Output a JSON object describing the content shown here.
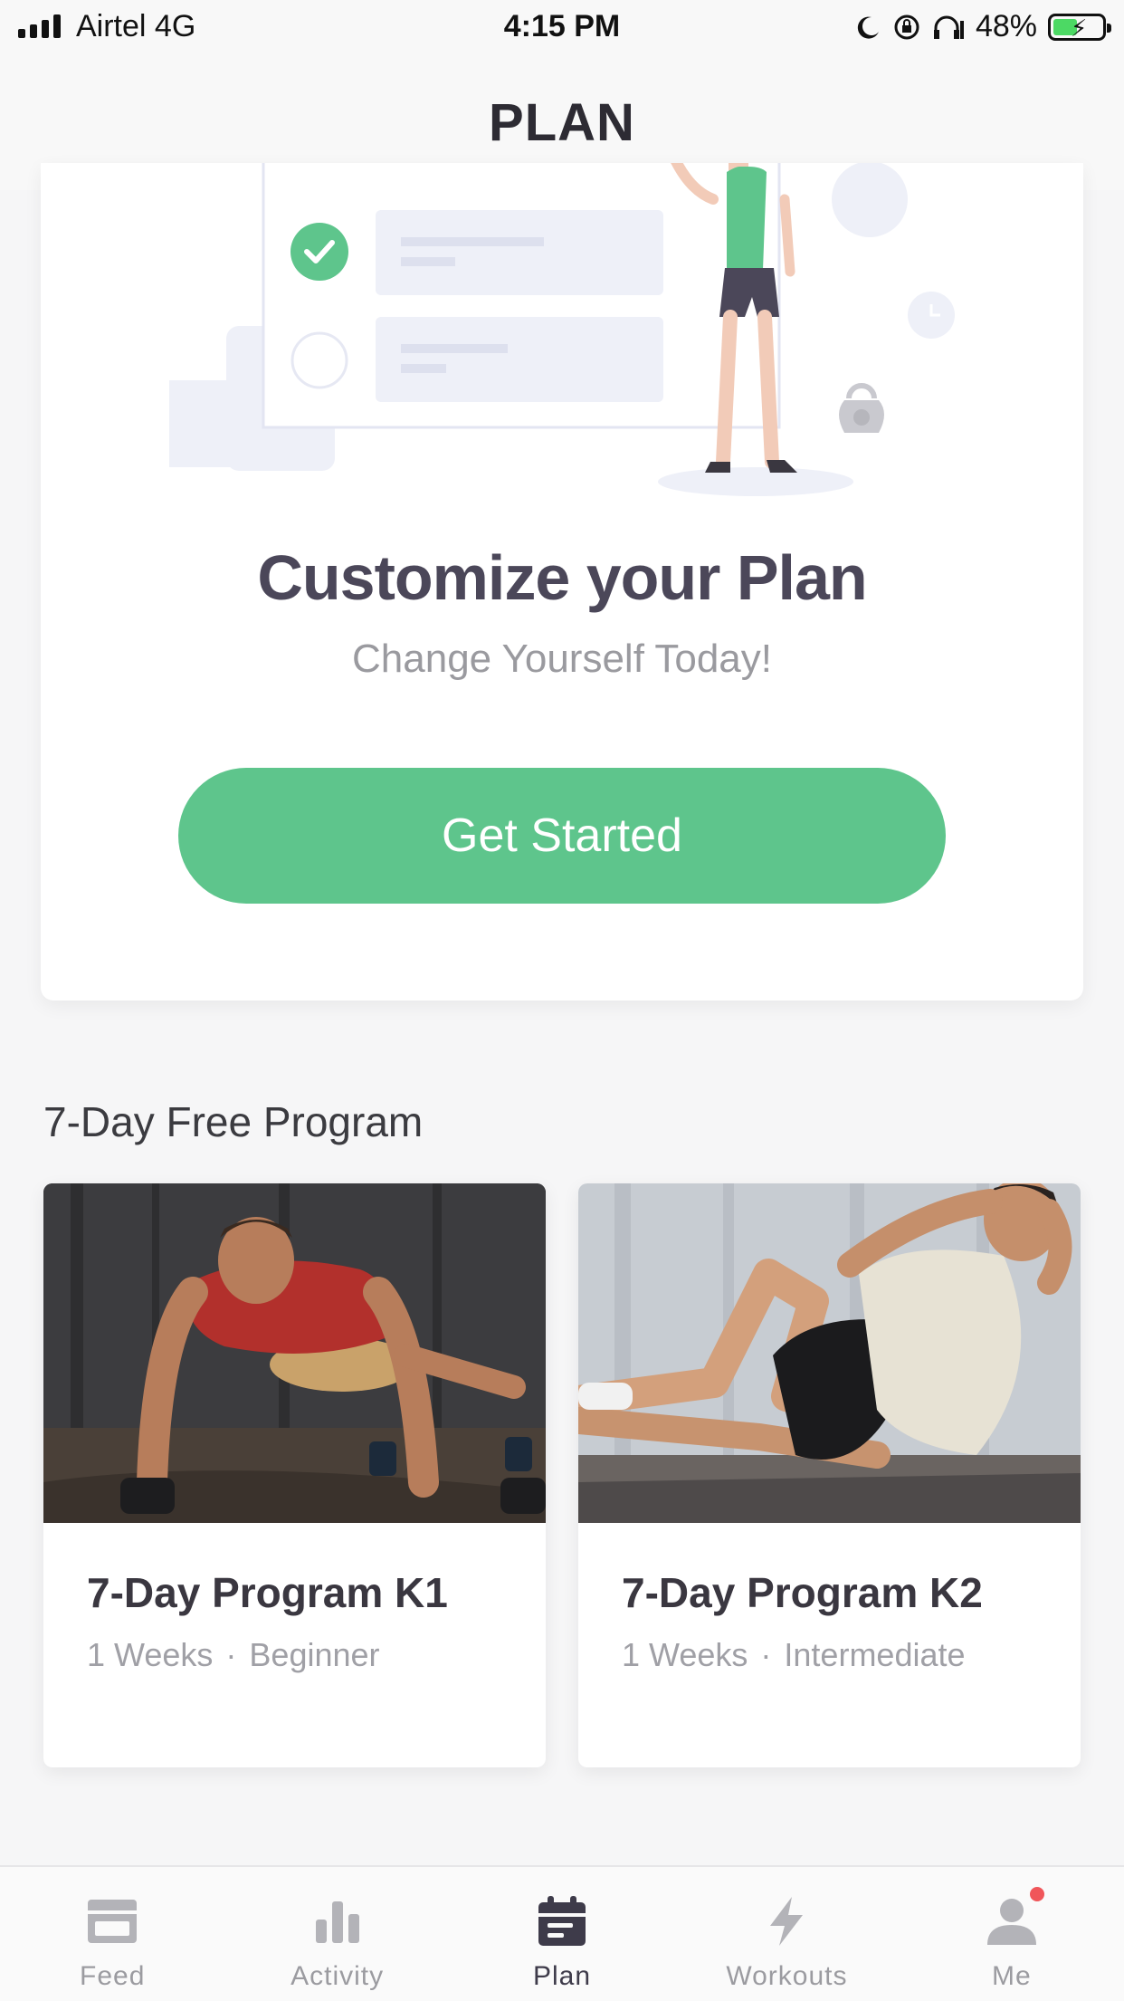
{
  "status_bar": {
    "carrier": "Airtel  4G",
    "time": "4:15 PM",
    "battery": "48%"
  },
  "nav": {
    "title": "PLAN"
  },
  "hero": {
    "title": "Customize your Plan",
    "subtitle": "Change Yourself Today!",
    "cta_label": "Get Started"
  },
  "section": {
    "title": "7-Day Free Program"
  },
  "programs": [
    {
      "name": "7-Day Program K1",
      "duration": "1 Weeks",
      "separator": "·",
      "level": "Beginner"
    },
    {
      "name": "7-Day Program K2",
      "duration": "1 Weeks",
      "separator": "·",
      "level": "Intermediate"
    }
  ],
  "tab_bar": {
    "active": "Plan",
    "tabs": [
      {
        "label": "Feed",
        "icon": "feed-icon"
      },
      {
        "label": "Activity",
        "icon": "activity-icon"
      },
      {
        "label": "Plan",
        "icon": "plan-icon"
      },
      {
        "label": "Workouts",
        "icon": "workouts-icon"
      },
      {
        "label": "Me",
        "icon": "me-icon"
      }
    ]
  },
  "colors": {
    "accent_green": "#5ec58c",
    "badge_red": "#f0565a",
    "active_tab": "#3e3b4a",
    "inactive_tab": "#9b9ba0"
  }
}
